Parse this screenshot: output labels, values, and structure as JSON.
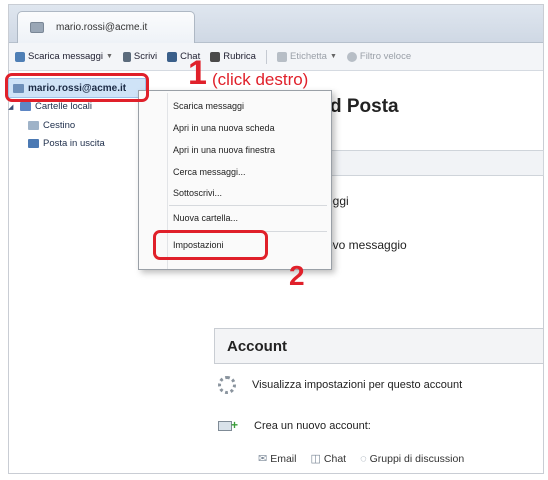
{
  "window": {
    "tab_title": "mario.rossi@acme.it"
  },
  "toolbar": {
    "get_messages": "Scarica messaggi",
    "write": "Scrivi",
    "chat": "Chat",
    "address_book": "Rubrica",
    "tag": "Etichetta",
    "quick_filter": "Filtro veloce"
  },
  "folders": {
    "account": "mario.rossi@acme.it",
    "local_folders": "Cartelle locali",
    "trash": "Cestino",
    "outbox": "Posta in uscita"
  },
  "main": {
    "title": "d Posta",
    "read_messages": "eggi",
    "write_new": "ovo messaggio",
    "account_section": "Account",
    "view_settings": "Visualizza impostazioni per questo account",
    "create_account": "Crea un nuovo account:",
    "email": "Email",
    "chat": "Chat",
    "newsgroups": "Gruppi di discussion"
  },
  "context_menu": {
    "get_messages": "Scarica messaggi",
    "open_new_tab": "Apri in una nuova scheda",
    "open_new_window": "Apri in una nuova finestra",
    "search_messages": "Cerca messaggi...",
    "subscribe": "Sottoscrivi...",
    "new_folder": "Nuova cartella...",
    "settings": "Impostazioni"
  },
  "annotations": {
    "step1_number": "1",
    "step1_text": "(click destro)",
    "step2_number": "2"
  },
  "colors": {
    "annotation_red": "#e0202a",
    "selection_blue": "#cfe3f7"
  }
}
